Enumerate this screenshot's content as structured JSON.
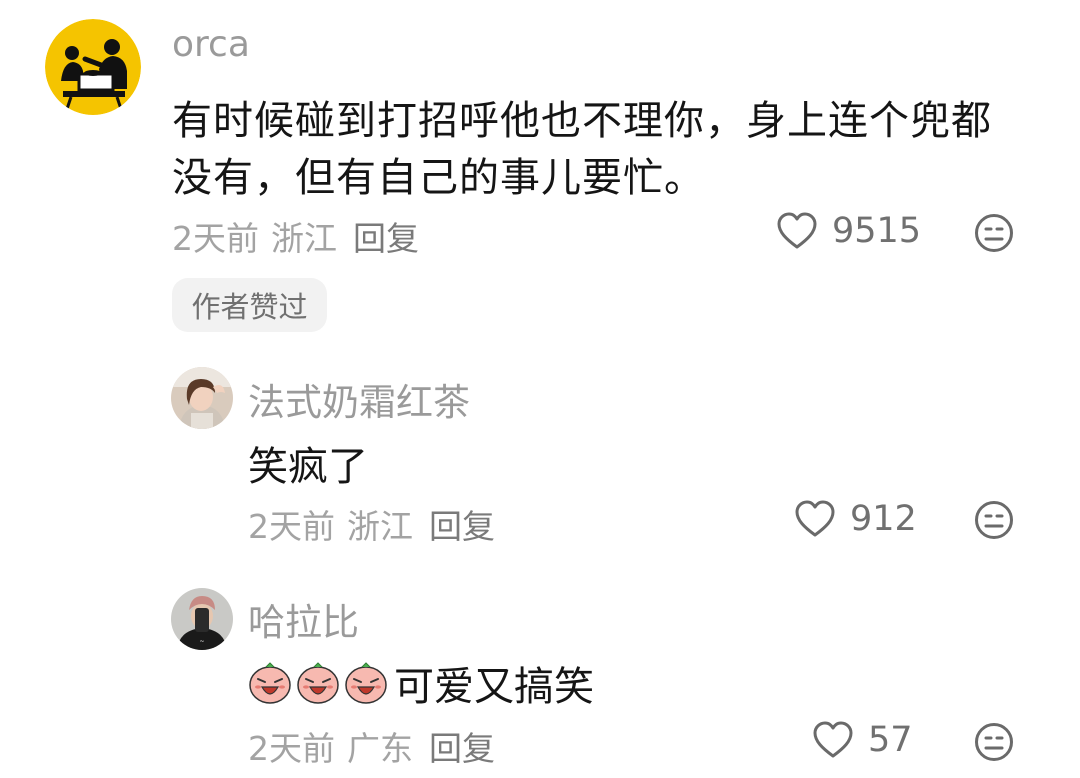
{
  "comment": {
    "username": "orca",
    "text_line1": "有时候碰到打招呼他也不理你，身上连个兜都",
    "text_line2": "没有，但有自己的事儿要忙。",
    "time": "2天前",
    "location": "浙江",
    "reply_label": "回复",
    "likes": "9515",
    "author_badge": "作者赞过"
  },
  "replies": [
    {
      "username": "法式奶霜红茶",
      "text": "笑疯了",
      "time": "2天前",
      "location": "浙江",
      "reply_label": "回复",
      "likes": "912"
    },
    {
      "username": "哈拉比",
      "emojis": [
        "crying-face-emoji",
        "crying-face-emoji",
        "crying-face-emoji"
      ],
      "text": "可爱又搞笑",
      "time": "2天前",
      "location": "广东",
      "reply_label": "回复",
      "likes": "57"
    }
  ],
  "colors": {
    "avatar_yellow": "#f5c400",
    "text": "#151515",
    "muted": "#a3a3a3"
  }
}
